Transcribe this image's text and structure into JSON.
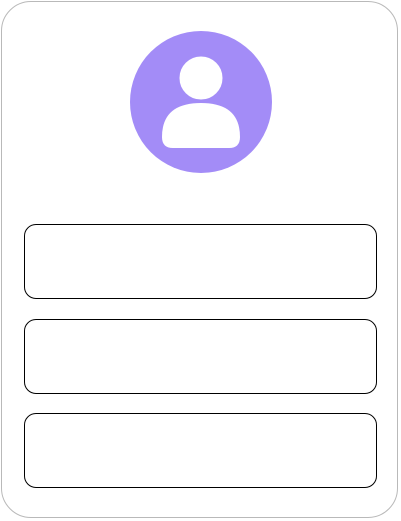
{
  "profile_card": {
    "avatar": {
      "icon": "user-icon",
      "background_color": "#a38cf7",
      "figure_color": "#ffffff"
    },
    "fields": [
      {
        "value": "",
        "placeholder": ""
      },
      {
        "value": "",
        "placeholder": ""
      },
      {
        "value": "",
        "placeholder": ""
      }
    ]
  }
}
